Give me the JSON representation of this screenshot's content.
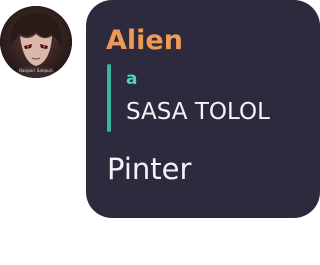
{
  "avatar": {
    "caption": "Ranpori Sanpuri",
    "icon": "user-avatar-icon"
  },
  "message": {
    "author": "Alien",
    "reply": {
      "author": "a",
      "text": "SASA TOLOL"
    },
    "text": "Pinter"
  },
  "colors": {
    "bubble_background": "#2c2a3c",
    "author_name": "#ee9a55",
    "reply_accent": "#35b7a1",
    "reply_author": "#4fd3c0",
    "message_text": "#f4f4f6"
  }
}
